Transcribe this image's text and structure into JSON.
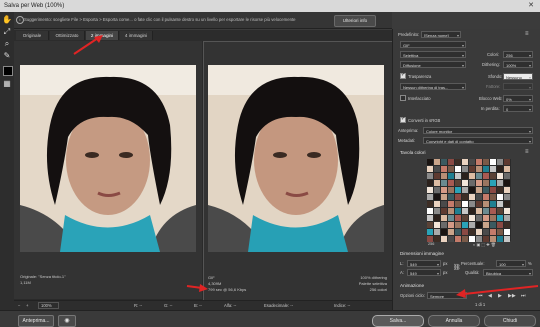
{
  "window": {
    "title": "Salva per Web (100%)",
    "close": "✕"
  },
  "infobar": {
    "text": "Suggerimento: scegliete File > Esporta > Esporta come... o fate clic con il pulsante destro su un livello per esportare le risorse più velocemente",
    "button": "Ulteriori info"
  },
  "tabs": [
    {
      "label": "Originale"
    },
    {
      "label": "Ottimizzato"
    },
    {
      "label": "2 immagini"
    },
    {
      "label": "4 immagini"
    }
  ],
  "left_pane": {
    "line1": "Originale: \"Senza titolo-1\"",
    "line2": "1,11M"
  },
  "right_pane": {
    "format": "GIF",
    "size": "4,309M",
    "time": "799 sec @ 56,6 Kbps",
    "right1": "100% dithering",
    "right2": "Palette selettiva",
    "right3": "256 colori"
  },
  "bottombar": {
    "zoom": "100%",
    "r": "R: --",
    "g": "G: --",
    "b": "B: --",
    "alpha": "Alfa: --",
    "hex": "Esadecimale: --",
    "index": "Indice: --"
  },
  "footer": {
    "preview": "Anteprima...",
    "save": "Salva...",
    "cancel": "Annulla",
    "done": "Chiudi"
  },
  "right": {
    "preset_label": "Predefinito:",
    "preset_value": "[Senza nome]",
    "format": "GIF",
    "reduction": "Selettiva",
    "colors_label": "Colori:",
    "colors_value": "256",
    "dither_algo": "Diffusione",
    "dither_label": "Dithering:",
    "dither_value": "100%",
    "transparency_label": "Trasparenza",
    "matte_label": "Sfondo:",
    "matte_value": "Nessuno",
    "trans_dither": "Nessun dithering di tras...",
    "amount_label": "Fattore:",
    "interlaced_label": "Interlacciato",
    "websnap_label": "Blocco Web:",
    "websnap_value": "0%",
    "lossy_label": "In perdita:",
    "lossy_value": "0",
    "convert_label": "Converti in sRGB",
    "preview_label": "Anteprima:",
    "preview_value": "Colore monitor",
    "metadata_label": "Metadati:",
    "metadata_value": "Copyright e dati di contatto",
    "colortable_label": "Tavola colori",
    "palette_count": "256",
    "imagesize_label": "Dimensioni immagine",
    "w_label": "L:",
    "w_value": "549",
    "h_label": "A:",
    "h_value": "549",
    "px": "px",
    "percent_label": "Percentuale:",
    "percent_value": "100",
    "percent_unit": "%",
    "quality_label": "Qualità:",
    "quality_value": "Bicubica",
    "animation_label": "Animazione",
    "loop_label": "Opzioni ciclo:",
    "loop_value": "Sempre",
    "frame_counter": "1 di 1"
  },
  "colors": {
    "accent": "#e02424",
    "panel": "#3a3a3a"
  }
}
